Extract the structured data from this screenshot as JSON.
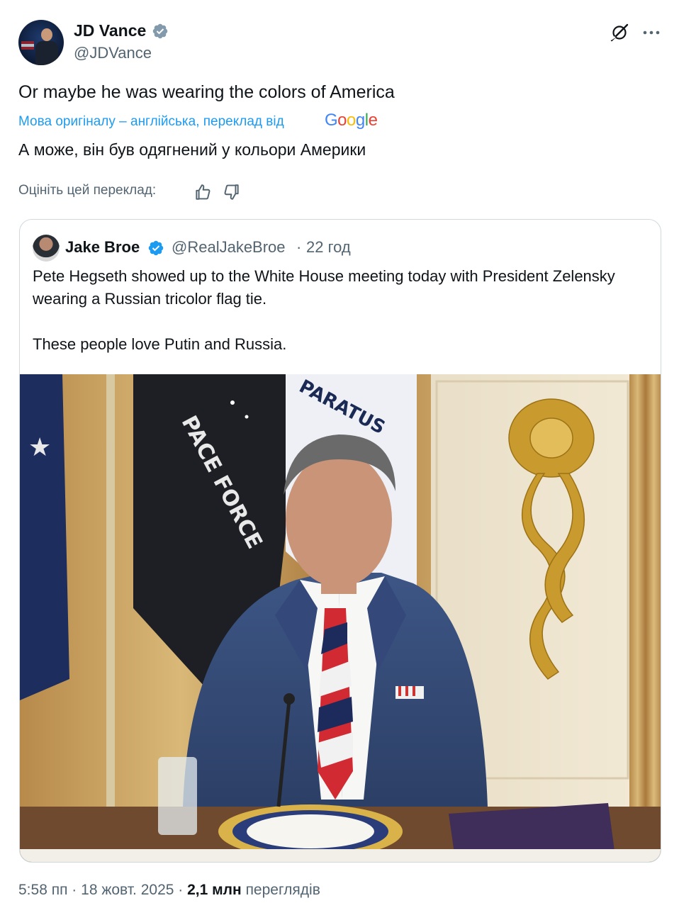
{
  "author": {
    "name": "JD Vance",
    "handle": "@JDVance"
  },
  "tweet": {
    "text": "Or maybe he was wearing the colors of America",
    "translation_note": "Мова оригіналу – англійська, переклад від",
    "translation_provider": "Google",
    "translated_text": "А може, він був одягнений у кольори Америки",
    "rate_label": "Оцініть цей переклад:"
  },
  "quote": {
    "name": "Jake Broe",
    "handle": "@RealJakeBroe",
    "separator": "·",
    "time": "22 год",
    "text_line1": "Pete Hegseth showed up to the White House meeting today with President Zelensky wearing a Russian tricolor flag tie.",
    "text_line2": "These people love Putin and Russia.",
    "photo_flag_text_1": "PACE FORCE",
    "photo_flag_text_2": "PARATUS"
  },
  "footer": {
    "time": "5:58 пп",
    "sep1": "·",
    "date": "18 жовт. 2025",
    "sep2": "·",
    "views_num": "2,1 млн",
    "views_label": "переглядів"
  },
  "colors": {
    "link_blue": "#1d9bf0",
    "secondary_gray": "#536471",
    "verified_blue": "#1d9bf0",
    "google_blue": "#4285f4",
    "google_red": "#ea4335",
    "google_yellow": "#fbbc05",
    "google_green": "#34a853"
  },
  "icons": {
    "verified": "verified-badge-icon",
    "grok": "grok-icon",
    "more": "more-icon",
    "thumb_up": "thumb-up-icon",
    "thumb_down": "thumb-down-icon"
  }
}
